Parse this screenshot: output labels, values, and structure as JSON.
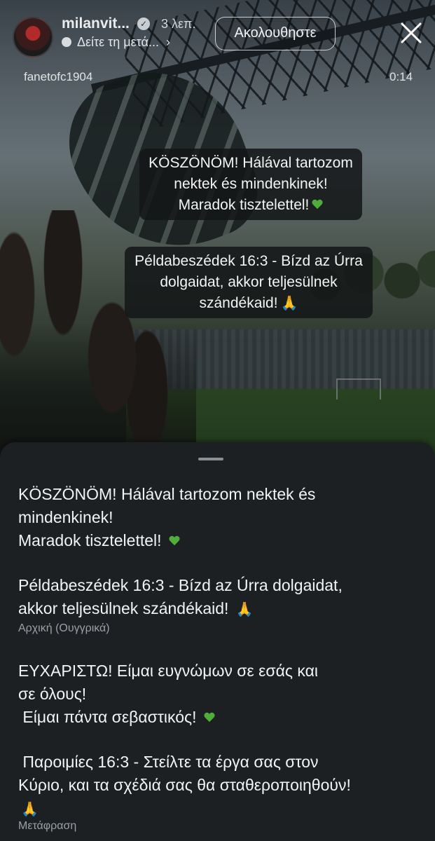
{
  "story": {
    "username": "milanvit...",
    "time_ago": "3 λεπ.",
    "translate_prompt": "Δείτε τη μετά...",
    "follow_label": "Ακολουθηστε",
    "inner_username": "fanetofc1904",
    "duration": "0:14",
    "sticker_1": {
      "line1": "KÖSZÖNÖM! Hálával tartozom",
      "line2": "nektek és mindenkinek!",
      "line3": "Maradok tisztelettel!"
    },
    "sticker_2": {
      "line1": "Példabeszédek 16:3 - Bízd az Úrra",
      "line2": "dolgaidat, akkor teljesülnek",
      "line3": "szándékaid!"
    }
  },
  "sheet": {
    "original_1": "KÖSZÖNÖM! Hálával tartozom nektek és\nmindenkinek!\nMaradok tisztelettel!",
    "original_2": "Példabeszédek 16:3 - Bízd az Úrra dolgaidat,\nakkor teljesülnek szándékaid!",
    "original_note": "Αρχική (Ουγγρικά)",
    "translation_1": "ΕΥΧΑΡΙΣΤΩ! Είμαι ευγνώμων σε εσάς και\nσε όλους!\n Είμαι πάντα σεβαστικός!",
    "translation_2": " Παροιμίες 16:3 - Στείλτε τα έργα σας στον\nΚύριο, και τα σχέδιά σας θα σταθεροποιηθούν!",
    "translation_note": "Μετάφραση"
  },
  "icons": {
    "verified": "verified-badge-icon",
    "close": "close-icon",
    "translate": "speech-bubble-icon",
    "heart": "green-heart-emoji",
    "pray": "folded-hands-emoji"
  },
  "colors": {
    "sheet_bg": "#1d2023",
    "heart": "#4fae3a",
    "note_text": "#9aa0a6"
  }
}
